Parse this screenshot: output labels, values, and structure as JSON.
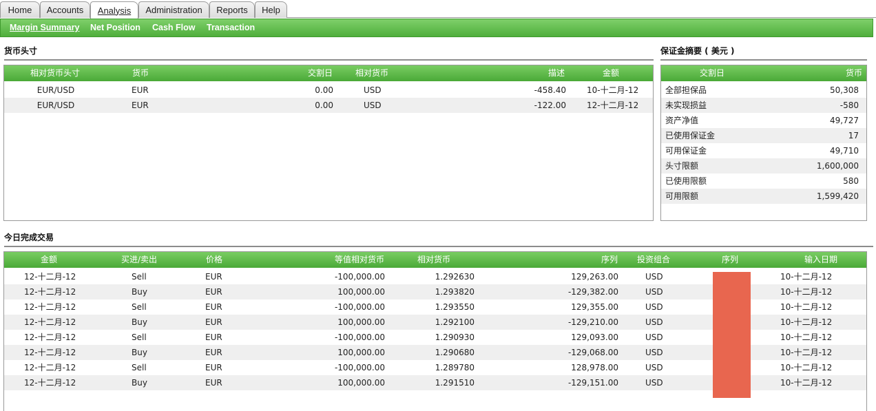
{
  "tabs": [
    {
      "label": "Home"
    },
    {
      "label": "Accounts"
    },
    {
      "label": "Analysis"
    },
    {
      "label": "Administration"
    },
    {
      "label": "Reports"
    },
    {
      "label": "Help"
    }
  ],
  "subnav": [
    "Margin Summary",
    "Net Position",
    "Cash Flow",
    "Transaction"
  ],
  "currency_positions": {
    "title": "货币头寸",
    "headers": [
      "相对货币头寸",
      "货币",
      "交割日",
      "相对货币",
      "描述",
      "金额"
    ],
    "rows": [
      [
        "EUR/USD",
        "EUR",
        "0.00",
        "USD",
        "-458.40",
        "10-十二月-12"
      ],
      [
        "EUR/USD",
        "EUR",
        "0.00",
        "USD",
        "-122.00",
        "12-十二月-12"
      ]
    ]
  },
  "margin_summary": {
    "title": "保证金摘要 ( 美元 )",
    "headers": [
      "交割日",
      "货币"
    ],
    "rows": [
      [
        "全部担保品",
        "50,308"
      ],
      [
        "未实现损益",
        "-580"
      ],
      [
        "资产净值",
        "49,727"
      ],
      [
        "已使用保证金",
        "17"
      ],
      [
        "可用保证金",
        "49,710"
      ],
      [
        "头寸限额",
        "1,600,000"
      ],
      [
        "已使用限额",
        "580"
      ],
      [
        "可用限额",
        "1,599,420"
      ]
    ]
  },
  "trades": {
    "title": "今日完成交易",
    "headers": [
      "金额",
      "买进/卖出",
      "价格",
      "等值相对货币",
      "相对货币",
      "序列",
      "投资组合",
      "序列",
      "输入日期"
    ],
    "rows": [
      [
        "12-十二月-12",
        "Sell",
        "EUR",
        "-100,000.00",
        "1.292630",
        "129,263.00",
        "USD",
        "",
        "10-十二月-12"
      ],
      [
        "12-十二月-12",
        "Buy",
        "EUR",
        "100,000.00",
        "1.293820",
        "-129,382.00",
        "USD",
        "",
        "10-十二月-12"
      ],
      [
        "12-十二月-12",
        "Sell",
        "EUR",
        "-100,000.00",
        "1.293550",
        "129,355.00",
        "USD",
        "",
        "10-十二月-12"
      ],
      [
        "12-十二月-12",
        "Buy",
        "EUR",
        "100,000.00",
        "1.292100",
        "-129,210.00",
        "USD",
        "",
        "10-十二月-12"
      ],
      [
        "12-十二月-12",
        "Sell",
        "EUR",
        "-100,000.00",
        "1.290930",
        "129,093.00",
        "USD",
        "",
        "10-十二月-12"
      ],
      [
        "12-十二月-12",
        "Buy",
        "EUR",
        "100,000.00",
        "1.290680",
        "-129,068.00",
        "USD",
        "",
        "10-十二月-12"
      ],
      [
        "12-十二月-12",
        "Sell",
        "EUR",
        "-100,000.00",
        "1.289780",
        "128,978.00",
        "USD",
        "",
        "10-十二月-12"
      ],
      [
        "12-十二月-12",
        "Buy",
        "EUR",
        "100,000.00",
        "1.291510",
        "-129,151.00",
        "USD",
        "",
        "10-十二月-12"
      ]
    ]
  },
  "colors": {
    "header_green": "#5cb847",
    "redaction": "#e8664f"
  }
}
